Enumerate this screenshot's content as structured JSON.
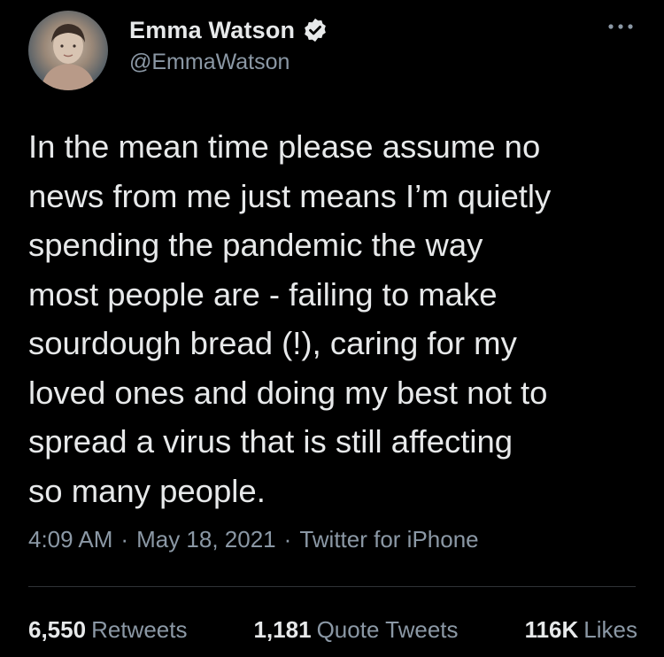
{
  "author": {
    "display_name": "Emma Watson",
    "handle": "@EmmaWatson",
    "verified": true,
    "avatar_icon": "profile-photo"
  },
  "tweet": {
    "text": "In the mean time please assume no\nnews from me just means I’m quietly\nspending the pandemic the way\nmost people are - failing to make\nsourdough bread (!), caring for my\nloved ones and doing my best not to\nspread a virus that is still affecting\nso many people."
  },
  "meta": {
    "time": "4:09 AM",
    "separator": "·",
    "date": "May 18, 2021",
    "source": "Twitter for iPhone"
  },
  "stats": {
    "retweets": {
      "count": "6,550",
      "label": "Retweets"
    },
    "quote_tweets": {
      "count": "1,181",
      "label": "Quote Tweets"
    },
    "likes": {
      "count": "116K",
      "label": "Likes"
    }
  },
  "colors": {
    "background": "#000000",
    "primary_text": "#e7e9ea",
    "secondary_text": "#8b98a5",
    "divider": "#2f3336"
  }
}
